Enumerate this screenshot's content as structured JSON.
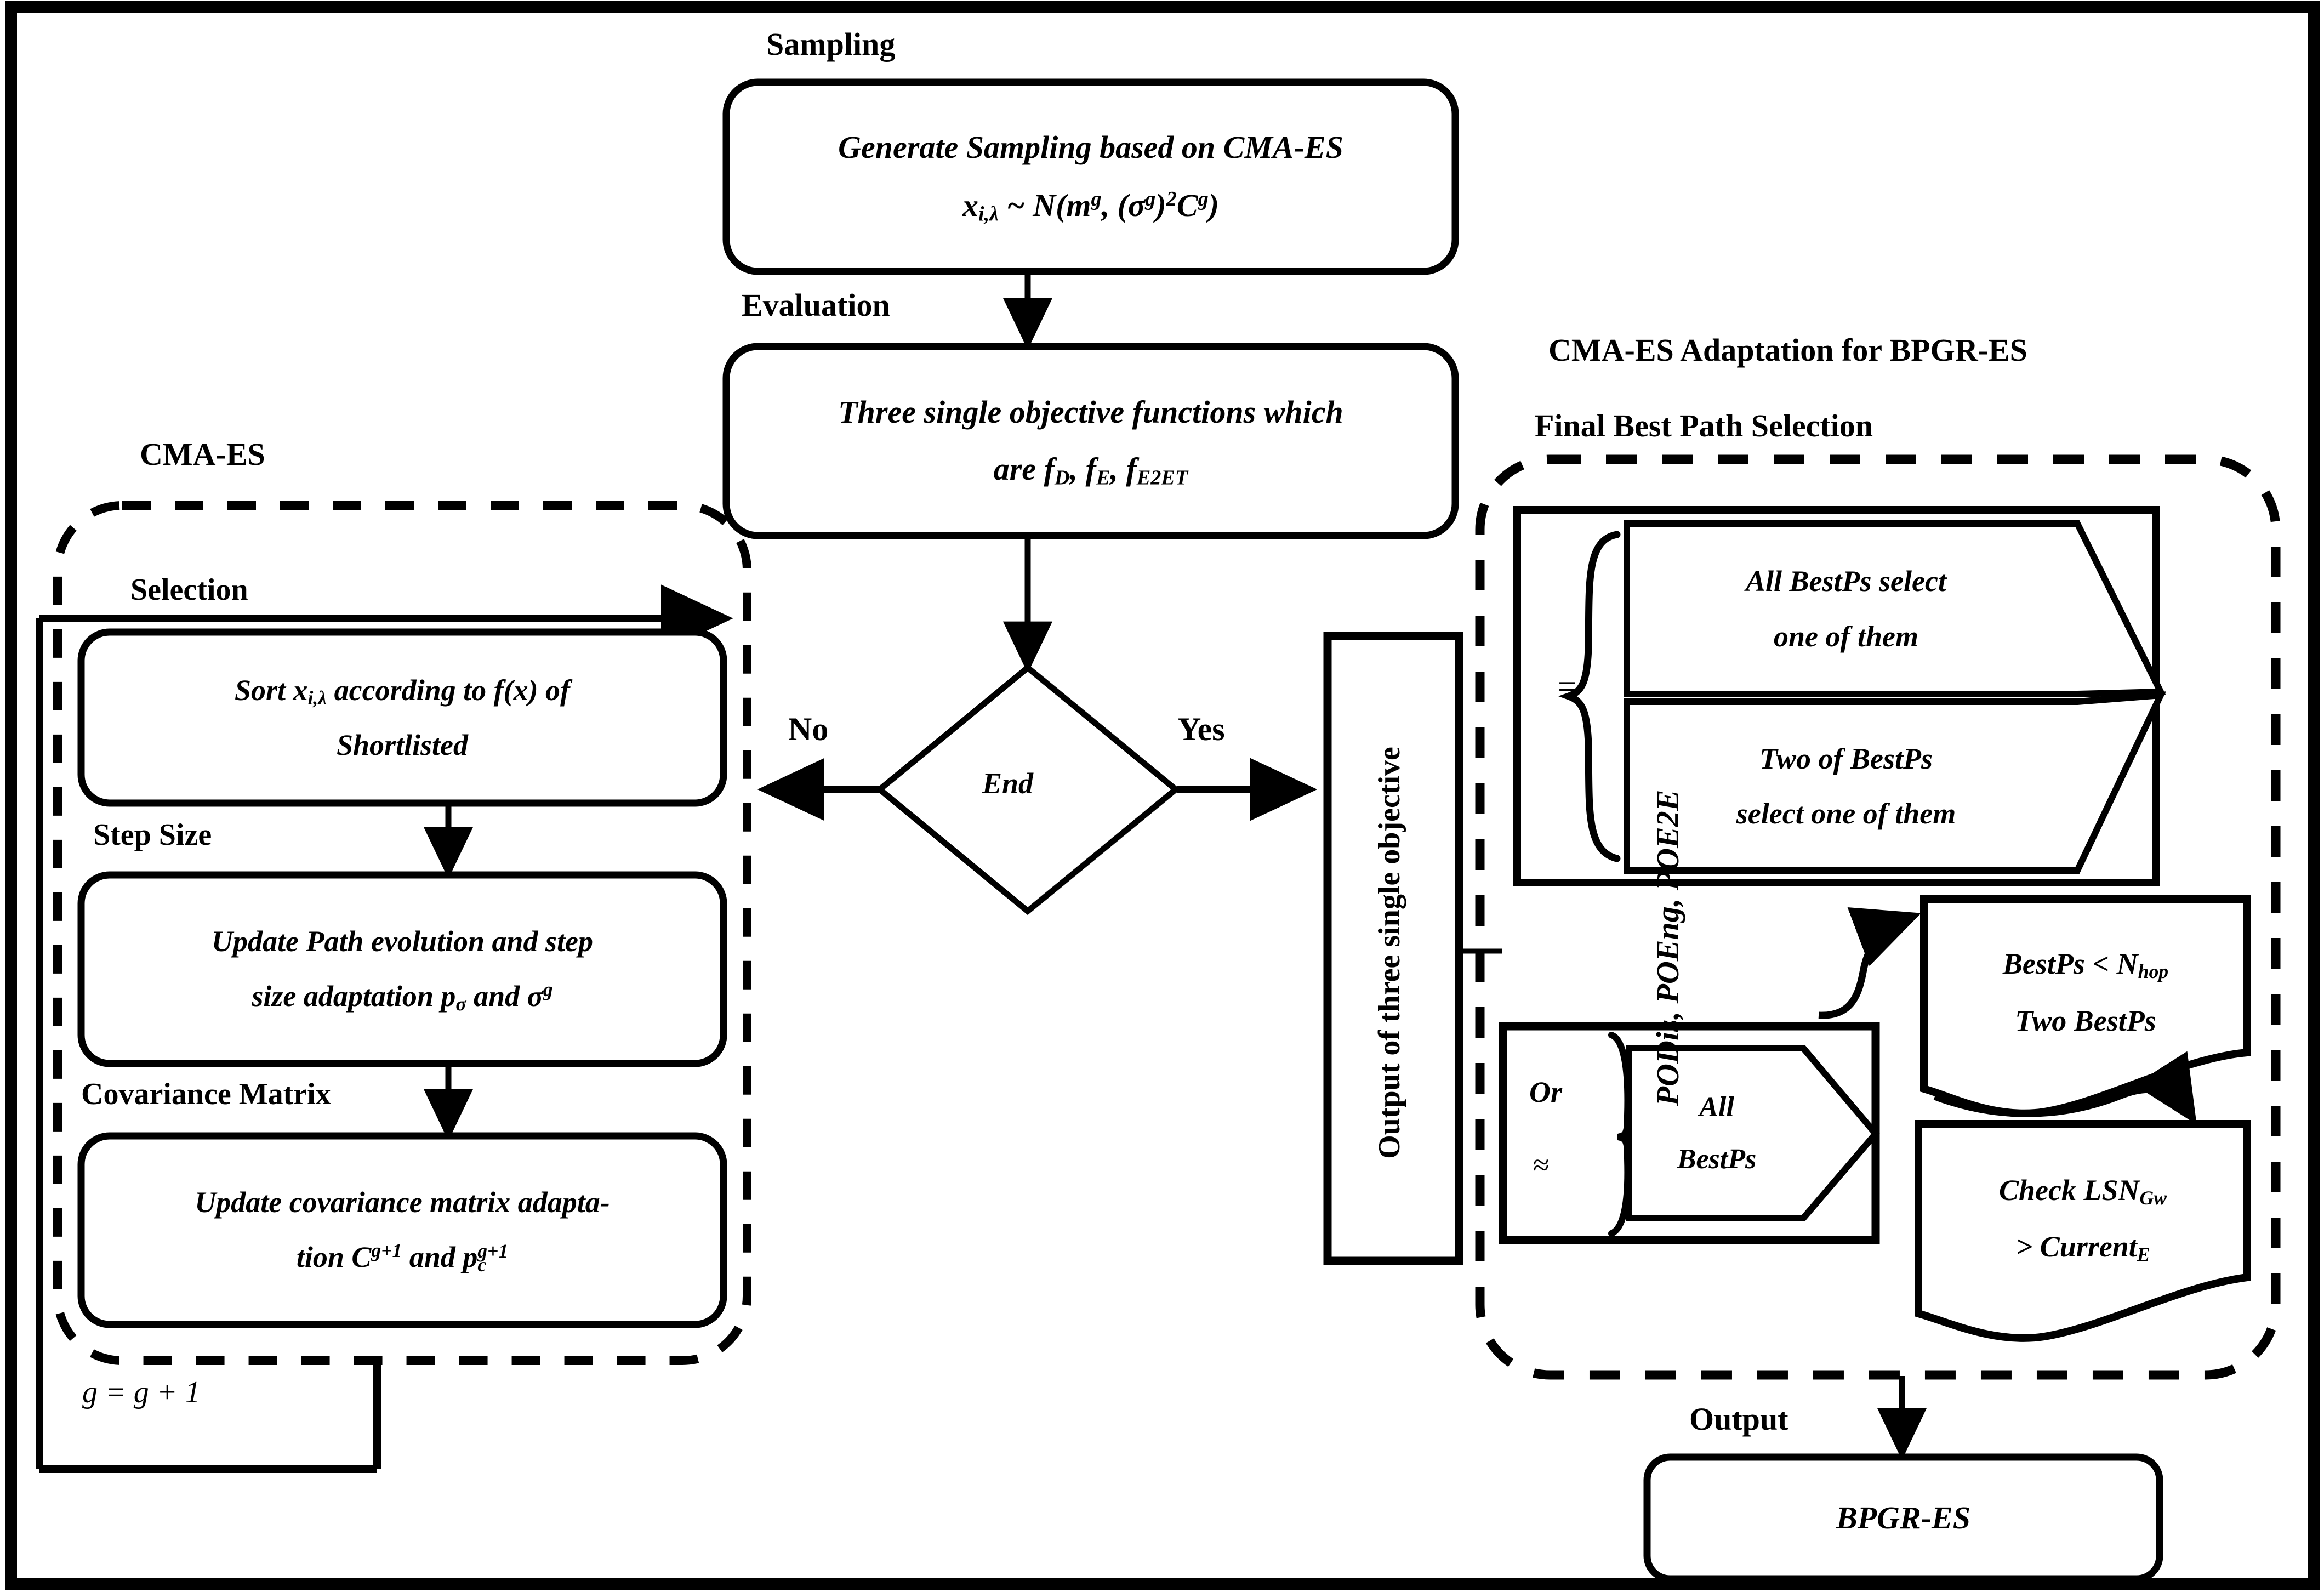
{
  "diagram": {
    "title_right_top": "CMA-ES  Adaptation  for  BPGR-ES",
    "section_labels": {
      "sampling": "Sampling",
      "evaluation": "Evaluation",
      "cma_es": "CMA-ES",
      "selection": "Selection",
      "step_size": "Step Size",
      "covariance_matrix": "Covariance Matrix",
      "final_best_path_selection": "Final Best Path Selection",
      "output": "Output"
    },
    "nodes": {
      "sampling_box": {
        "line1": "Generate Sampling based on CMA-ES",
        "line2_prefix": "x",
        "line2_sub": "i,λ",
        "line2_rest": " ~ N(m",
        "line2_sup1": "g",
        "line2_mid": ", (σ",
        "line2_sup2": "g",
        "line2_mid2": ")",
        "line2_sup3": "2",
        "line2_c": "C",
        "line2_sup4": "g",
        "line2_end": ")"
      },
      "evaluation_box": {
        "line1": "Three single objective functions which",
        "line2_prefix": "are f",
        "line2_sub1": "D",
        "line2_m1": ", f",
        "line2_sub2": "E",
        "line2_m2": ", f",
        "line2_sub3": "E2ET"
      },
      "selection_box": {
        "line1_a": "Sort x",
        "line1_sub": "i,λ",
        "line1_b": " according to f(x) of",
        "line2": "Shortlisted"
      },
      "step_size_box": {
        "line1": "Update Path evolution and step",
        "line2_a": "size adaptation p",
        "line2_sub": "σ",
        "line2_b": " and σ",
        "line2_sup": "g"
      },
      "covariance_box": {
        "line1": "Update covariance matrix adapta-",
        "line2_a": "tion C",
        "line2_sup1": "g+1",
        "line2_b": " and p",
        "line2_sub": "c",
        "line2_sup2": "g+1"
      },
      "decision_end": "End",
      "decision_no": "No",
      "decision_yes": "Yes",
      "output_column_label": "Output of three single objective",
      "output_column_value": "PODis, POEng, POE2E",
      "equals_sign": "=",
      "all_bestps_box": {
        "line1": "All BestPs select",
        "line2": "one of them"
      },
      "two_bestps_box": {
        "line1": "Two of BestPs",
        "line2": "select one of them"
      },
      "or_label": "Or",
      "approx_label": "≈",
      "all_bestps_small": {
        "line1": "All",
        "line2": "BestPs"
      },
      "bestps_nhop_box": {
        "line1_a": "BestPs < N",
        "line1_sub": "hop",
        "line2": "Two BestPs"
      },
      "check_lsn_box": {
        "line1_a": "Check LSN",
        "line1_sub": "Gw",
        "line2_a": "> Current",
        "line2_sub": "E"
      },
      "final_output_box": "BPGR-ES",
      "generation_counter": "g = g + 1"
    },
    "colors": {
      "stroke": "#000000",
      "fill": "#ffffff",
      "background": "#ffffff"
    }
  }
}
